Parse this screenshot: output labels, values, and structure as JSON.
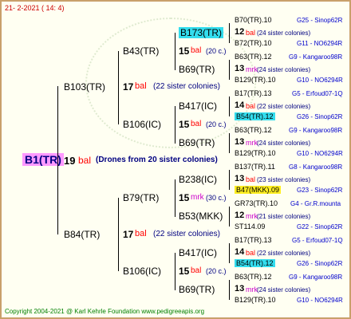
{
  "header": "21-   2-2021  (  14:   4)",
  "footer": "Copyright 2004-2021 @ Karl Kehrle Foundation    www.pedigreeapis.org",
  "root": {
    "name": "B1(TR)",
    "num": "19",
    "bal": "bal",
    "drones": "(Drones from 20 sister colonies)"
  },
  "gen1": [
    {
      "name": "B103(TR)",
      "num": "17",
      "tag": "bal",
      "colonies": "(22 sister colonies)"
    },
    {
      "name": "B84(TR)",
      "num": "17",
      "tag": "bal",
      "colonies": "(22 sister colonies)"
    }
  ],
  "gen2": [
    {
      "name": "B43(TR)",
      "num": "15",
      "tag": "bal",
      "colonies": "(20 c.)"
    },
    {
      "name": "B106(IC)",
      "num": "15",
      "tag": "bal",
      "colonies": "(20 c.)"
    },
    {
      "name": "B79(TR)",
      "num": "15",
      "tag": "mrk",
      "colonies": "(30 c.)"
    },
    {
      "name": "B106(IC)",
      "num": "15",
      "tag": "bal",
      "colonies": "(20 c.)"
    }
  ],
  "gen3": [
    {
      "name": "B173(TR)",
      "num": "12",
      "tag": "bal",
      "colonies": "(24 sister colonies)"
    },
    {
      "name": "B69(TR)",
      "num": "13",
      "tag": "mrk",
      "colonies": "(24 sister colonies)"
    },
    {
      "name": "B417(IC)",
      "num": "14",
      "tag": "bal",
      "colonies": "(22 sister colonies)"
    },
    {
      "name": "B69(TR)",
      "num": "13",
      "tag": "mrk",
      "colonies": "(24 sister colonies)"
    },
    {
      "name": "B238(IC)",
      "num": "13",
      "tag": "bal",
      "colonies": "(23 sister colonies)"
    },
    {
      "name": "B53(MKK)",
      "num": "12",
      "tag": "mrk",
      "colonies": "(21 sister colonies)"
    },
    {
      "name": "B417(IC)",
      "num": "14",
      "tag": "bal",
      "colonies": "(22 sister colonies)"
    },
    {
      "name": "B69(TR)",
      "num": "13",
      "tag": "mrk",
      "colonies": "(24 sister colonies)"
    }
  ],
  "gen4": [
    {
      "name": "B70(TR).10",
      "note": "G25 - Sinop62R"
    },
    {
      "name": "B72(TR).10",
      "note": "G11 - NO6294R"
    },
    {
      "name": "B63(TR).12",
      "note": "G9 - Kangaroo98R"
    },
    {
      "name": "B129(TR).10",
      "note": "G10 - NO6294R"
    },
    {
      "name": "B17(TR).13",
      "note": "G5 - Erfoud07-1Q"
    },
    {
      "name": "B54(TR).12",
      "note": "G26 - Sinop62R"
    },
    {
      "name": "B63(TR).12",
      "note": "G9 - Kangaroo98R"
    },
    {
      "name": "B129(TR).10",
      "note": "G10 - NO6294R"
    },
    {
      "name": "B137(TR).11",
      "note": "G8 - Kangaroo98R"
    },
    {
      "name": "B47(MKK).09",
      "note": "G23 - Sinop62R"
    },
    {
      "name": "GR73(TR).10",
      "note": "G4 - Gr.R.mounta"
    },
    {
      "name": "ST114.09",
      "note": "G22 - Sinop62R"
    },
    {
      "name": "B17(TR).13",
      "note": "G5 - Erfoud07-1Q"
    },
    {
      "name": "B54(TR).12",
      "note": "G26 - Sinop62R"
    },
    {
      "name": "B63(TR).12",
      "note": "G9 - Kangaroo98R"
    },
    {
      "name": "B129(TR).10",
      "note": "G10 - NO6294R"
    }
  ]
}
